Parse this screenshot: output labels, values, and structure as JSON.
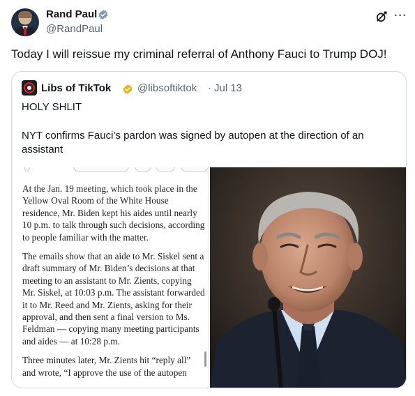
{
  "author": {
    "name": "Rand Paul",
    "handle": "@RandPaul",
    "verified_color": "#829aab"
  },
  "tweet": {
    "text": "Today I will reissue my criminal referral of Anthony Fauci to Trump DOJ!"
  },
  "quoted": {
    "name": "Libs of TikTok",
    "handle": "@libsoftiktok",
    "separator": "·",
    "date": "Jul 13",
    "verified_color": "#e2b719",
    "line1": "HOLY SHLIT",
    "line2": "NYT confirms Fauci’s pardon was signed by autopen at the direction of an assistant"
  },
  "article": {
    "p1": "At the Jan. 19 meeting, which took place in the Yellow Oval Room of the White House residence, Mr. Biden kept his aides until nearly 10 p.m. to talk through such decisions, according to people familiar with the matter.",
    "p2": "The emails show that an aide to Mr. Siskel sent a draft summary of Mr. Biden’s decisions at that meeting to an assistant to Mr. Zients, copying Mr. Siskel, at 10:03 p.m. The assistant forwarded it to Mr. Reed and Mr. Zients, asking for their approval, and then sent a final version to Ms. Feldman — copying many meeting participants and aides — at 10:28 p.m.",
    "p3": "Three minutes later, Mr. Zients hit “reply all” and wrote, “I approve the use of the autopen"
  },
  "icons": {
    "grok": "grok-icon",
    "more": "more-icon",
    "verified": "verified-badge-icon"
  },
  "more_glyph": "···"
}
